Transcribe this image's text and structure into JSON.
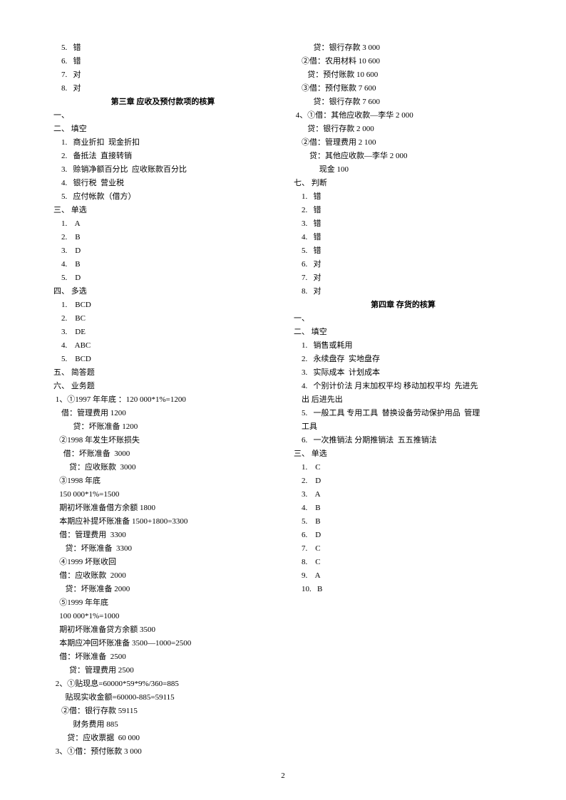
{
  "left": {
    "pre1": [
      "    5.   错",
      "    6.   错",
      "    7.   对",
      "    8.   对"
    ],
    "h1": "第三章   应收及预付款项的核算",
    "s1": "一、",
    "s2": "二、 填空",
    "fill2": [
      "    1.   商业折扣  现金折扣",
      "    2.   备抵法  直接转销",
      "    3.   赊销净额百分比  应收账款百分比",
      "    4.   银行税  营业税",
      "    5.   应付帐款（借方）"
    ],
    "s3": "三、 单选",
    "mc3": [
      "    1.    A",
      "    2.    B",
      "    3.    D",
      "    4.    B",
      "    5.    D"
    ],
    "s4": "四、 多选",
    "mc4": [
      "    1.    BCD",
      "    2.    BC",
      "    3.    DE",
      "    4.    ABC",
      "    5.    BCD"
    ],
    "s5": "五、 简答题",
    "s6": "六、 业务题",
    "biz": [
      " 1、①1997 年年底 ：120 000*1%=1200",
      "    借：管理费用 1200",
      "          贷：坏账准备 1200",
      "   ②1998 年发生坏账损失",
      "     借：坏账准备  3000",
      "        贷：应收账款  3000",
      "   ③1998 年底",
      "   150 000*1%=1500",
      "   期初坏账准备借方余额 1800",
      "   本期应补提坏账准备 1500+1800=3300",
      "   借：管理费用  3300",
      "      贷：坏账准备  3300",
      "   ④1999 坏账收回",
      "   借：应收账款  2000",
      "      贷：坏账准备 2000",
      "   ⑤1999 年年底",
      "   100 000*1%=1000",
      "   期初坏账准备贷方余额 3500",
      "   本期应冲回坏账准备 3500—1000=2500",
      "   借：坏账准备  2500",
      "        贷：管理费用 2500"
    ]
  },
  "right": {
    "block1": [
      " 2、①贴现息=60000*59*9%/360=885",
      "      贴现实收金额=60000-885=59115",
      "    ②借：银行存款 59115",
      "          财务费用 885",
      "       贷：应收票据  60 000",
      " 3、①借：预付账款 3 000",
      "          贷：银行存款 3 000",
      "    ②借：农用材料 10 600",
      "       贷：预付账款 10 600",
      "    ③借：预付账款 7 600",
      "          贷：银行存款 7 600",
      " 4、①借：其他应收款—李华 2 000",
      "       贷：银行存款 2 000",
      "    ②借：管理费用 2 100",
      "        贷：其他应收款—李华 2 000",
      "             现金 100"
    ],
    "s7": "七、 判断",
    "judge": [
      "    1.   错",
      "    2.   错",
      "    3.   错",
      "    4.   错",
      "    5.   错",
      "    6.   对",
      "    7.   对",
      "    8.   对"
    ],
    "h4": "第四章   存货的核算",
    "s1b": "一、",
    "s2b": "二、 填空",
    "fill2b": [
      "    1.   销售或耗用",
      "    2.   永续盘存  实地盘存",
      "    3.   实际成本  计划成本",
      "    4.   个别计价法 月末加权平均 移动加权平均  先进先",
      "    出 后进先出",
      "    5.   一般工具 专用工具  替换设备劳动保护用品  管理",
      "    工具",
      "    6.   一次推销法 分期推销法  五五推销法"
    ],
    "s3b": "三、 单选",
    "mc3b": [
      "    1.    C",
      "    2.    D",
      "    3.    A",
      "    4.    B",
      "    5.    B",
      "    6.    D",
      "    7.    C",
      "    8.    C",
      "    9.    A",
      "    10.   B"
    ]
  },
  "pagenum": "2"
}
